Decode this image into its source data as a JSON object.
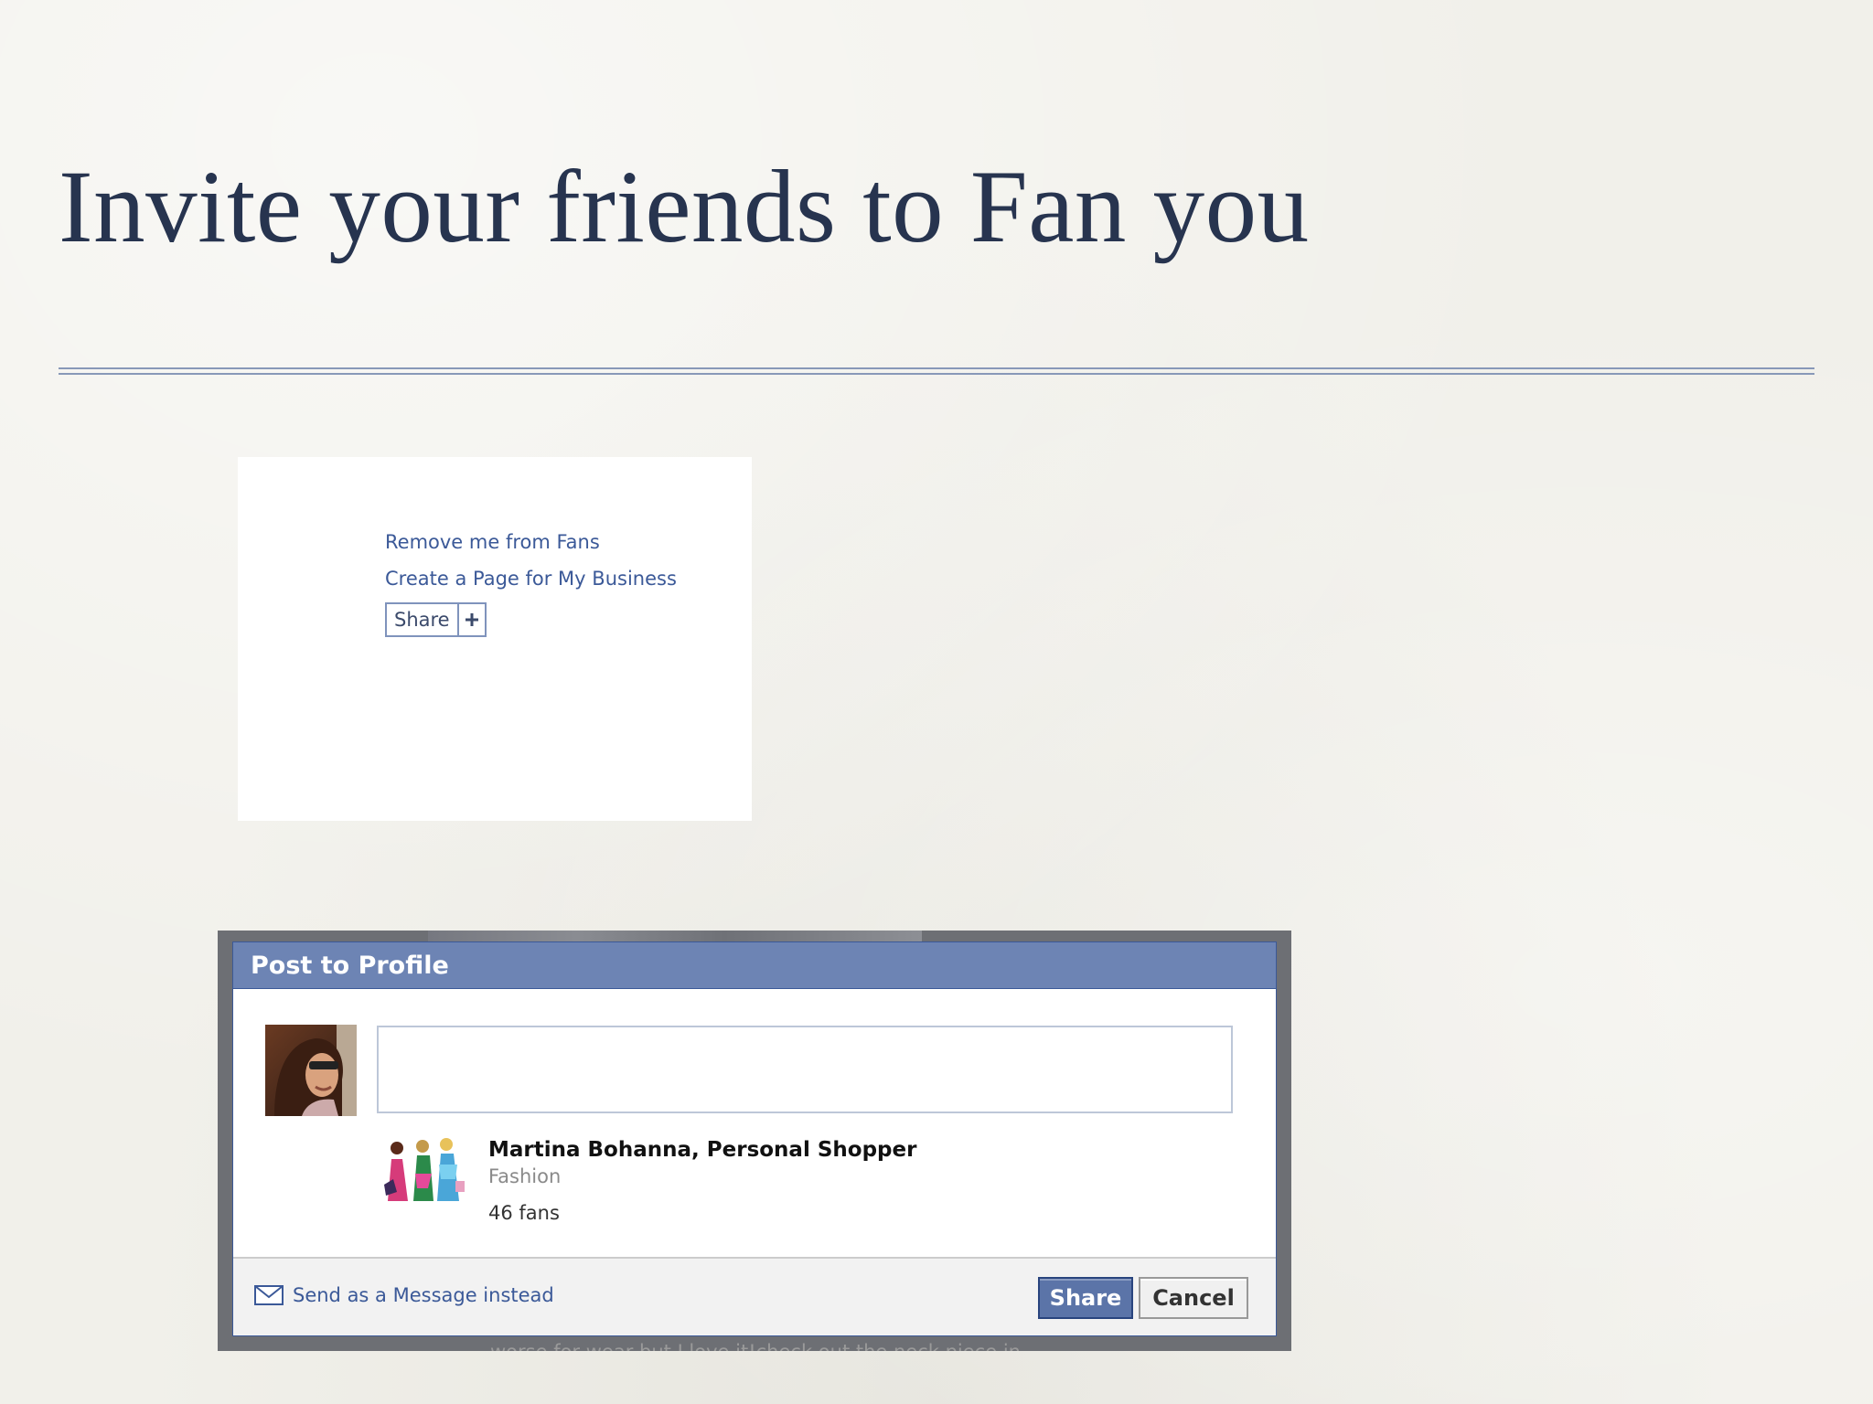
{
  "slide": {
    "title": "Invite your friends to Fan you"
  },
  "page_sidebar": {
    "remove_fan_link": "Remove me from Fans",
    "create_page_link": "Create a Page for My Business",
    "share_button_label": "Share",
    "share_plus_icon": "plus-icon"
  },
  "post_dialog": {
    "title": "Post to Profile",
    "avatar_icon": "user-avatar",
    "message_input_value": "",
    "attachment": {
      "thumbnail_icon": "fashion-illustration",
      "name": "Martina Bohanna, Personal Shopper",
      "category": "Fashion",
      "fans": "46 fans"
    },
    "footer": {
      "send_message_icon": "envelope-icon",
      "send_message_label": "Send as a Message instead",
      "share_label": "Share",
      "cancel_label": "Cancel"
    },
    "colors": {
      "header": "#6d84b4",
      "link": "#3b5998",
      "share_button": "#5b74a8"
    }
  },
  "background_text": "worse for wear but I love it!check out the neck piece in"
}
